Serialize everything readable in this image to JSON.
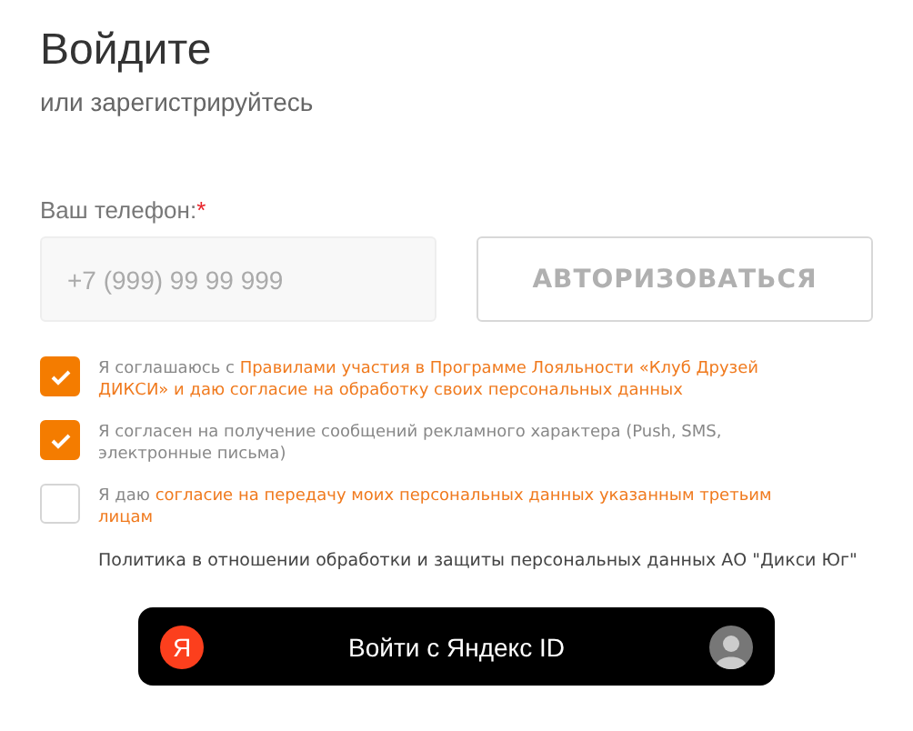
{
  "heading": "Войдите",
  "subheading": "или зарегистрируйтесь",
  "phone": {
    "label": "Ваш телефон:",
    "required_mark": "*",
    "placeholder": "+7 (999) 99 99 999"
  },
  "submit": {
    "label": "АВТОРИЗОВАТЬСЯ",
    "disabled": true
  },
  "consents": [
    {
      "text": "Я соглашаюсь с",
      "link": "Правилами участия в Программе Лояльности «Клуб Друзей ДИКСИ» и даю согласие на обработку своих персональных данных",
      "checked": true
    },
    {
      "text": "Я согласен на получение сообщений рекламного характера (Push, SMS, электронные письма)",
      "checked": true
    },
    {
      "text": "Я даю",
      "link": "согласие на передачу моих персональных данных указанным третьим лицам",
      "checked": false
    }
  ],
  "policy": "Политика в отношении обработки и защиты персональных данных АО \"Дикси Юг\"",
  "yandex": {
    "logo": "Я",
    "label": "Войти с Яндекс ID"
  }
}
